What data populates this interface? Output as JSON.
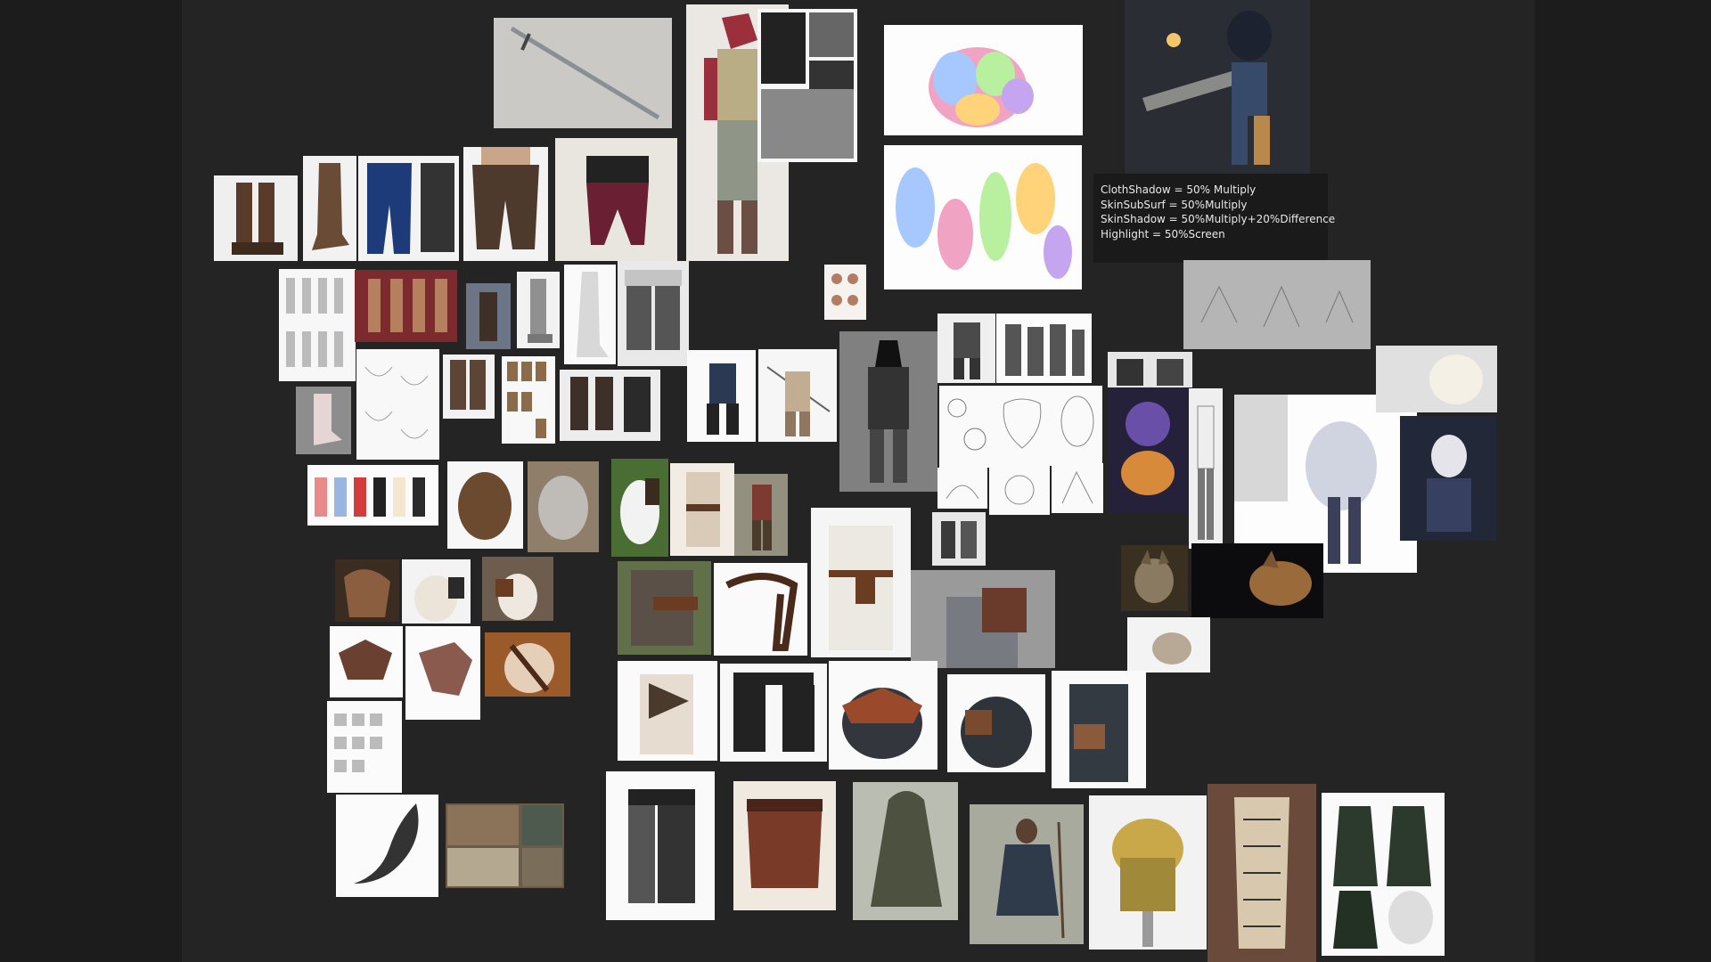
{
  "canvas": {
    "background": "#242424",
    "outer_background": "#1c1c1c"
  },
  "note": {
    "lines": [
      "ClothShadow = 50% Multiply",
      "SkinSubSurf = 50%Multiply",
      "SkinShadow = 50%Multiply+20%Difference",
      "Highlight = 50%Screen"
    ]
  },
  "references": [
    {
      "name": "sword",
      "icon": "sword-icon"
    },
    {
      "name": "wolf-warrior-character",
      "icon": "character-icon"
    },
    {
      "name": "manga-page",
      "icon": "comic-icon"
    },
    {
      "name": "muscle-color-map",
      "icon": "anatomy-icon"
    },
    {
      "name": "arm-muscle-sketches",
      "icon": "anatomy-icon"
    },
    {
      "name": "shading-demo-character",
      "icon": "character-icon"
    },
    {
      "name": "leather-boots",
      "icon": "boot-icon"
    },
    {
      "name": "slouch-boot",
      "icon": "boot-icon"
    },
    {
      "name": "harem-pants",
      "icon": "pants-icon"
    },
    {
      "name": "brown-harem-pants",
      "icon": "pants-icon"
    },
    {
      "name": "sash-skirt",
      "icon": "skirt-icon"
    },
    {
      "name": "wolf-head-sketches",
      "icon": "sketch-icon"
    },
    {
      "name": "leg-wrap-chart",
      "icon": "chart-icon"
    },
    {
      "name": "wolf-tail",
      "icon": "tail-icon"
    },
    {
      "name": "wolf-pack-photos",
      "icon": "wolf-icon"
    },
    {
      "name": "wolf-portrait",
      "icon": "wolf-icon"
    },
    {
      "name": "wolf-profile",
      "icon": "wolf-icon"
    },
    {
      "name": "snow-wolf",
      "icon": "wolf-icon"
    },
    {
      "name": "leather-belt",
      "icon": "belt-icon"
    },
    {
      "name": "shoulder-pauldron",
      "icon": "armor-icon"
    },
    {
      "name": "green-cloak",
      "icon": "cloak-icon"
    },
    {
      "name": "wanderer-photo",
      "icon": "person-icon"
    },
    {
      "name": "leather-corset",
      "icon": "corset-icon"
    },
    {
      "name": "green-dress",
      "icon": "dress-icon"
    }
  ]
}
